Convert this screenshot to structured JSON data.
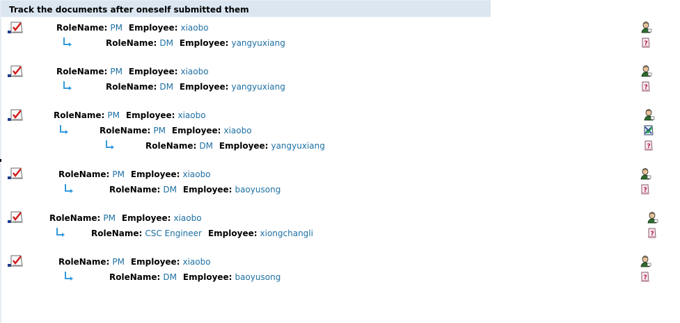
{
  "title": "Track the documents after oneself submitted them",
  "labels": {
    "role": "RoleName:",
    "employee": "Employee:"
  },
  "colors": {
    "header_bg": "#dbe6f1",
    "value_text": "#1c6fa3",
    "arrow": "#3399dd"
  },
  "groups": [
    {
      "entries": [
        {
          "role": "PM",
          "employee": "xiaobo",
          "status_icon": "person-icon"
        },
        {
          "role": "DM",
          "employee": "yangyuxiang",
          "status_icon": "pending-doc-icon"
        }
      ]
    },
    {
      "entries": [
        {
          "role": "PM",
          "employee": "xiaobo",
          "status_icon": "person-icon"
        },
        {
          "role": "DM",
          "employee": "yangyuxiang",
          "status_icon": "pending-doc-icon"
        }
      ]
    },
    {
      "entries": [
        {
          "role": "PM",
          "employee": "xiaobo",
          "status_icon": "person-icon"
        },
        {
          "role": "PM",
          "employee": "xiaobo",
          "status_icon": "approved-check-icon"
        },
        {
          "role": "DM",
          "employee": "yangyuxiang",
          "status_icon": "pending-doc-icon"
        }
      ]
    },
    {
      "entries": [
        {
          "role": "PM",
          "employee": "xiaobo",
          "status_icon": "person-icon"
        },
        {
          "role": "DM",
          "employee": "baoyusong",
          "status_icon": "pending-doc-icon"
        }
      ]
    },
    {
      "entries": [
        {
          "role": "PM",
          "employee": "xiaobo",
          "status_icon": "person-icon"
        },
        {
          "role": "CSC Engineer",
          "employee": "xiongchangli",
          "status_icon": "pending-doc-icon"
        }
      ]
    },
    {
      "entries": [
        {
          "role": "PM",
          "employee": "xiaobo",
          "status_icon": "person-icon"
        },
        {
          "role": "DM",
          "employee": "baoyusong",
          "status_icon": "pending-doc-icon"
        }
      ]
    }
  ]
}
